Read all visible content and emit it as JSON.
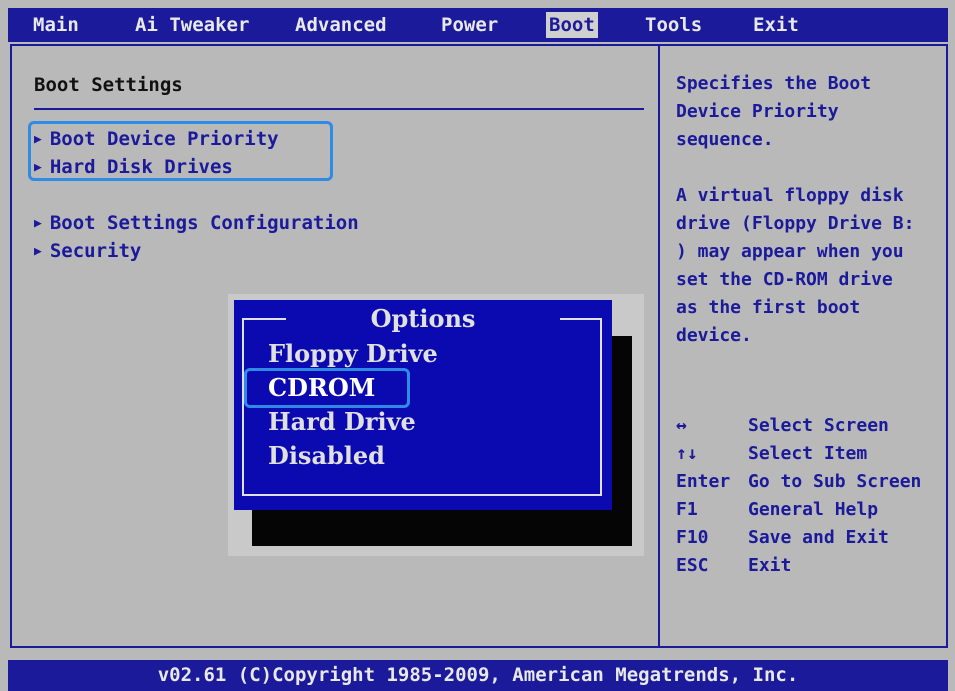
{
  "menu": [
    {
      "label": "Main",
      "active": false
    },
    {
      "label": "Ai Tweaker",
      "active": false
    },
    {
      "label": "Advanced",
      "active": false
    },
    {
      "label": "Power",
      "active": false
    },
    {
      "label": "Boot",
      "active": true
    },
    {
      "label": "Tools",
      "active": false
    },
    {
      "label": "Exit",
      "active": false
    }
  ],
  "main": {
    "section_title": "Boot Settings",
    "entries": [
      {
        "label": "Boot Device Priority"
      },
      {
        "label": "Hard Disk Drives"
      },
      {
        "label": "Boot Settings Configuration"
      },
      {
        "label": "Security"
      }
    ]
  },
  "popup": {
    "title": "Options",
    "options": [
      "Floppy Drive",
      "CDROM",
      "Hard Drive",
      "Disabled"
    ],
    "selected": "CDROM"
  },
  "help": {
    "description": "Specifies the Boot\nDevice Priority\nsequence.\n\nA virtual floppy disk\ndrive (Floppy Drive B:\n) may appear when you\nset the CD-ROM drive\nas the first boot\ndevice.",
    "keys": [
      {
        "key": "↔",
        "desc": "Select Screen"
      },
      {
        "key": "↑↓",
        "desc": "Select Item"
      },
      {
        "key": "Enter",
        "desc": "Go to Sub Screen"
      },
      {
        "key": "F1",
        "desc": "General Help"
      },
      {
        "key": "F10",
        "desc": "Save and Exit"
      },
      {
        "key": "ESC",
        "desc": "Exit"
      }
    ]
  },
  "footer": "v02.61 (C)Copyright 1985-2009, American Megatrends, Inc.",
  "colors": {
    "bios_blue": "#1a1a9a",
    "popup_blue": "#0a0ab0",
    "background_gray": "#b9b9b9",
    "highlight": "#2f8be6"
  }
}
